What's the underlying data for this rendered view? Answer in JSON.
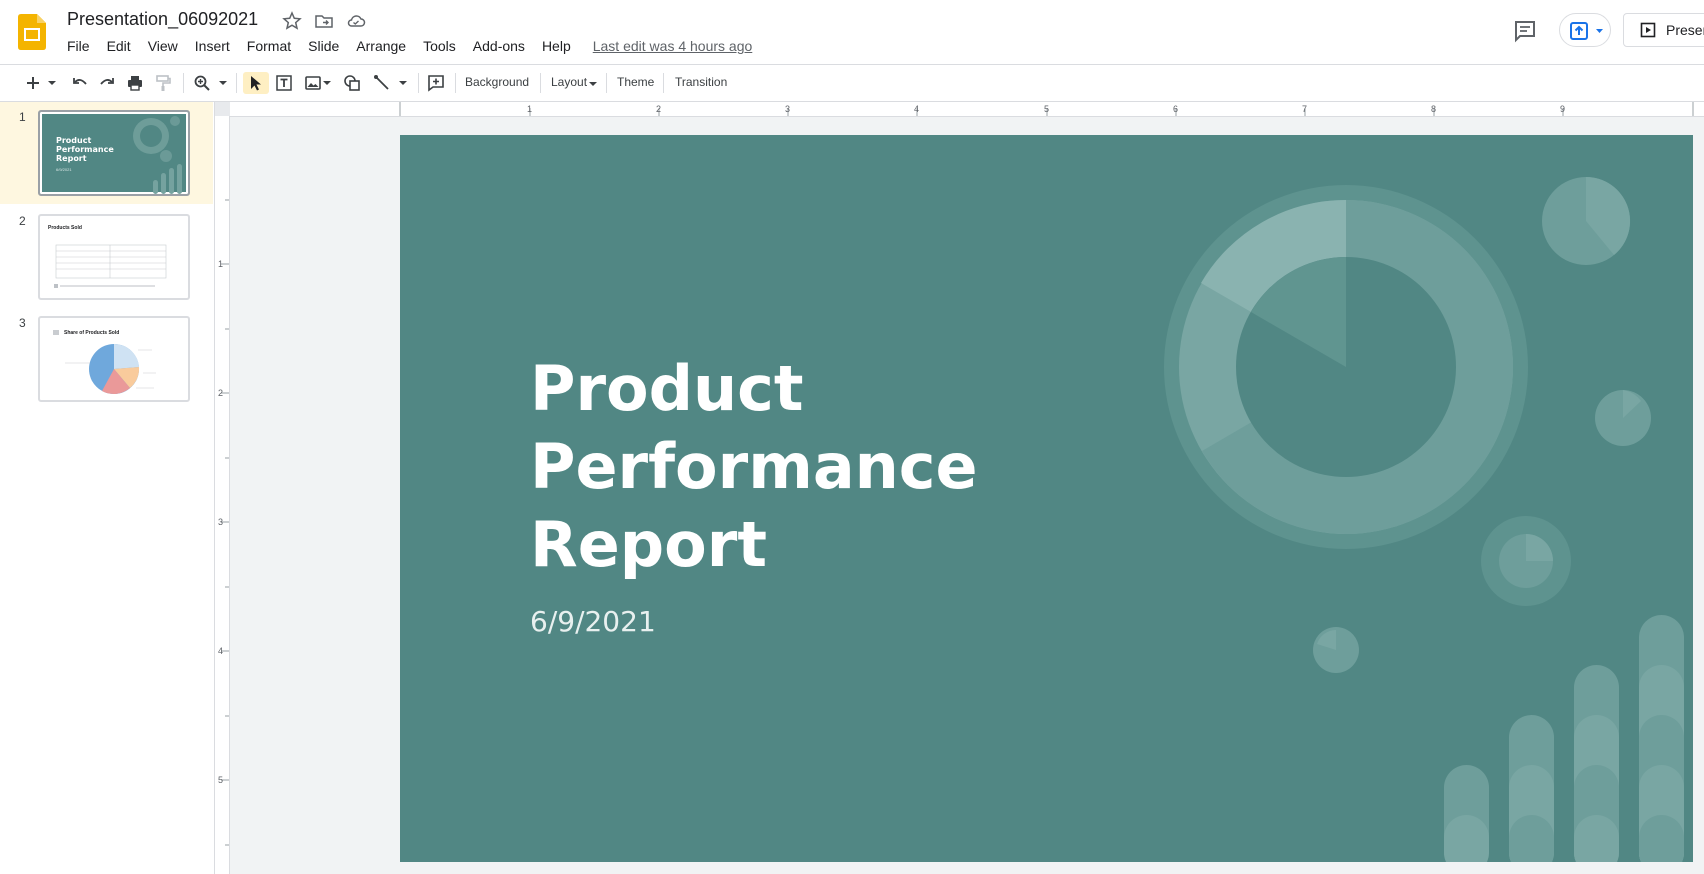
{
  "app": {
    "title": "Presentation_06092021",
    "last_edit": "Last edit was 4 hours ago"
  },
  "menu": [
    "File",
    "Edit",
    "View",
    "Insert",
    "Format",
    "Slide",
    "Arrange",
    "Tools",
    "Add-ons",
    "Help"
  ],
  "toolbar": {
    "background": "Background",
    "layout": "Layout",
    "theme": "Theme",
    "transition": "Transition"
  },
  "header_buttons": {
    "present": "Presen"
  },
  "filmstrip": {
    "slides": [
      {
        "num": "1",
        "title": "Product Performance Report",
        "subtitle": "6/9/2021"
      },
      {
        "num": "2",
        "title": "Products Sold"
      },
      {
        "num": "3",
        "title": "Share of Products Sold"
      }
    ]
  },
  "slide": {
    "title": "Product\nPerformance\nReport",
    "date": "6/9/2021"
  },
  "rulers": {
    "h": [
      "1",
      "2",
      "3",
      "4",
      "5",
      "6",
      "7",
      "8",
      "9"
    ],
    "v": [
      "1",
      "2",
      "3",
      "4",
      "5"
    ]
  },
  "colors": {
    "slide_bg": "#518784",
    "accent": "#f4b400",
    "selection": "#feefc3"
  }
}
